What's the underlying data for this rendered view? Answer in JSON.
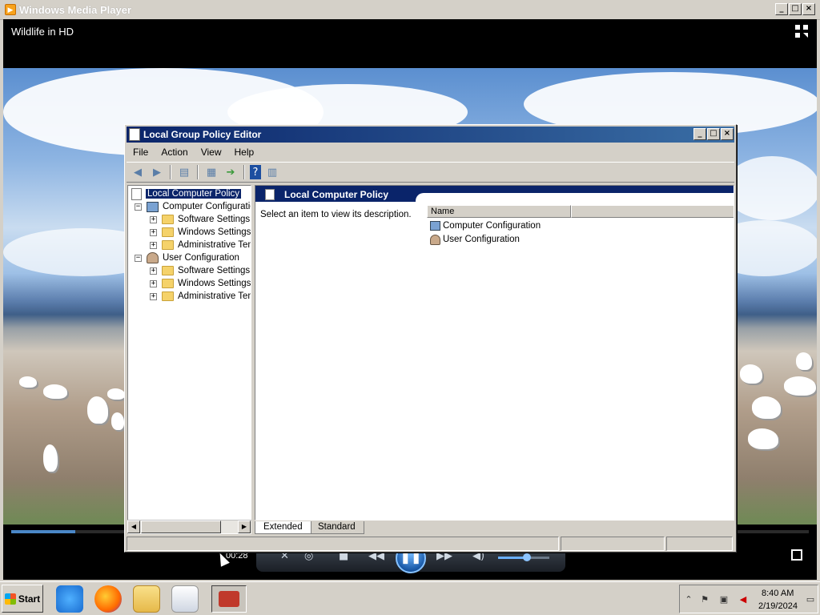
{
  "wmp": {
    "title": "Windows Media Player",
    "video_title": "Wildlife in HD",
    "timecode": "00:28",
    "progress": 0.08,
    "volume": 0.55,
    "title_buttons": [
      "_",
      "□",
      "×"
    ]
  },
  "gpedit": {
    "title": "Local Group Policy Editor",
    "menu": [
      "File",
      "Action",
      "View",
      "Help"
    ],
    "toolbar": [
      "back-arrow-icon",
      "forward-arrow-icon",
      "show-hide-tree-icon",
      "properties-icon",
      "export-list-icon",
      "help-icon",
      "extended-view-icon"
    ],
    "tree": {
      "root": "Local Computer Policy",
      "computer_config": "Computer Configuratio",
      "computer_children": [
        "Software Settings",
        "Windows Settings",
        "Administrative Tem"
      ],
      "user_config": "User Configuration",
      "user_children": [
        "Software Settings",
        "Windows Settings",
        "Administrative Tem"
      ]
    },
    "right": {
      "header": "Local Computer Policy",
      "description": "Select an item to view its description.",
      "column_name": "Name",
      "items": [
        "Computer Configuration",
        "User Configuration"
      ]
    },
    "tabs": [
      "Extended",
      "Standard"
    ]
  },
  "taskbar": {
    "start_label": "Start",
    "apps": [
      "internet-explorer-icon",
      "firefox-icon",
      "file-explorer-icon",
      "media-player-icon",
      "toolbox-icon"
    ],
    "clock_time": "8:40 AM",
    "clock_date": "2/19/2024"
  },
  "colors": {
    "title_active": "#0a246a",
    "accent": "#3a6ea5",
    "wmp_blue": "#4a87c7"
  }
}
